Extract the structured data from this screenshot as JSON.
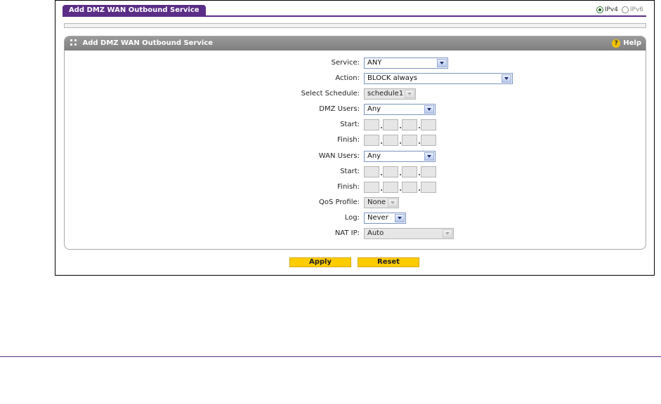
{
  "tab": {
    "title": "Add DMZ WAN Outbound Service"
  },
  "ip_version": {
    "options": [
      "IPv4",
      "IPv6"
    ],
    "selected": "IPv4"
  },
  "panel": {
    "title": "Add DMZ WAN Outbound Service",
    "help_label": "Help"
  },
  "form": {
    "service": {
      "label": "Service:",
      "value": "ANY"
    },
    "action": {
      "label": "Action:",
      "value": "BLOCK always"
    },
    "schedule": {
      "label": "Select Schedule:",
      "value": "schedule1"
    },
    "dmz_users": {
      "label": "DMZ Users:",
      "value": "Any",
      "start_label": "Start:",
      "finish_label": "Finish:"
    },
    "wan_users": {
      "label": "WAN Users:",
      "value": "Any",
      "start_label": "Start:",
      "finish_label": "Finish:"
    },
    "qos_profile": {
      "label": "QoS Profile:",
      "value": "None"
    },
    "log": {
      "label": "Log:",
      "value": "Never"
    },
    "nat_ip": {
      "label": "NAT IP:",
      "value": "Auto"
    }
  },
  "buttons": {
    "apply": "Apply",
    "reset": "Reset"
  },
  "colors": {
    "accent": "#5a2d86",
    "button": "#ffcc00",
    "panel_header": "#8a8a8a"
  }
}
